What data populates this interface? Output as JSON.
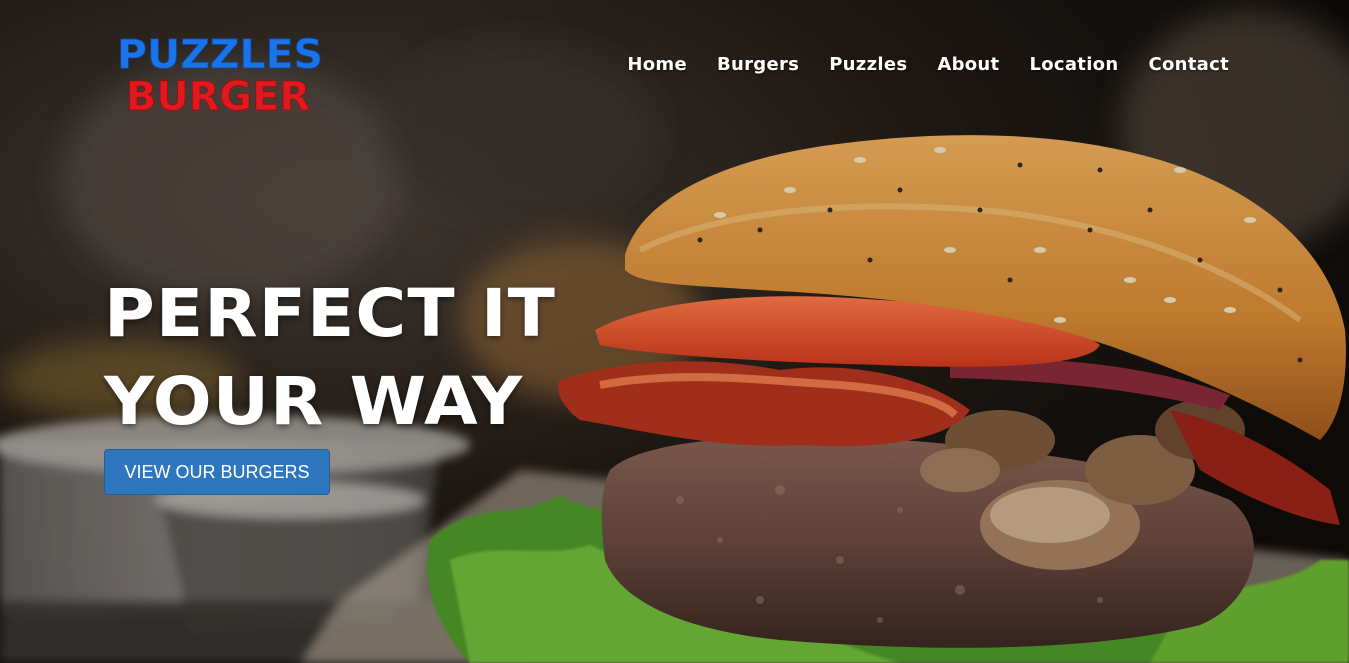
{
  "brand": {
    "line1": "PUZZLES",
    "line2": "BURGER",
    "color1": "#1a73e8",
    "color2": "#e0191f"
  },
  "nav": {
    "items": [
      {
        "label": "Home"
      },
      {
        "label": "Burgers"
      },
      {
        "label": "Puzzles"
      },
      {
        "label": "About"
      },
      {
        "label": "Location"
      },
      {
        "label": "Contact"
      }
    ]
  },
  "hero": {
    "headline_line1": "Perfect it",
    "headline_line2": "your way",
    "cta_label": "VIEW OUR BURGERS",
    "cta_color": "#2e76bd",
    "image": "burger-photo"
  }
}
